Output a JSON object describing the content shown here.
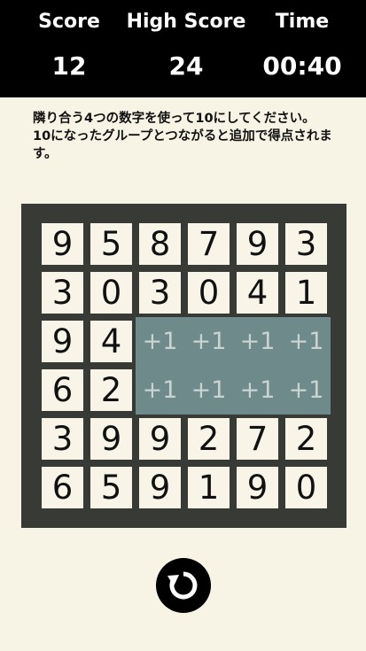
{
  "header": {
    "score_label": "Score",
    "score_value": "12",
    "high_score_label": "High Score",
    "high_score_value": "24",
    "time_label": "Time",
    "time_value": "00:40"
  },
  "instructions": {
    "line1": "隣り合う4つの数字を使って10にしてください。",
    "line2": "10になったグループとつながると追加で得点されます。"
  },
  "grid": [
    [
      "9",
      "5",
      "8",
      "7",
      "9",
      "3"
    ],
    [
      "3",
      "0",
      "3",
      "0",
      "4",
      "1"
    ],
    [
      "9",
      "4",
      "+1",
      "+1",
      "+1",
      "+1"
    ],
    [
      "6",
      "2",
      "+1",
      "+1",
      "+1",
      "+1"
    ],
    [
      "3",
      "9",
      "9",
      "2",
      "7",
      "2"
    ],
    [
      "6",
      "5",
      "9",
      "1",
      "9",
      "0"
    ]
  ],
  "bonus_text": "+1",
  "reset_icon": "refresh-icon",
  "colors": {
    "header_bg": "#000000",
    "board_bg": "#383a36",
    "cell_bg": "#f8f5e8",
    "bonus_bg": "#6f8a8a",
    "bonus_text": "#c9d3d2",
    "page_bg": "#f7f4e6"
  }
}
